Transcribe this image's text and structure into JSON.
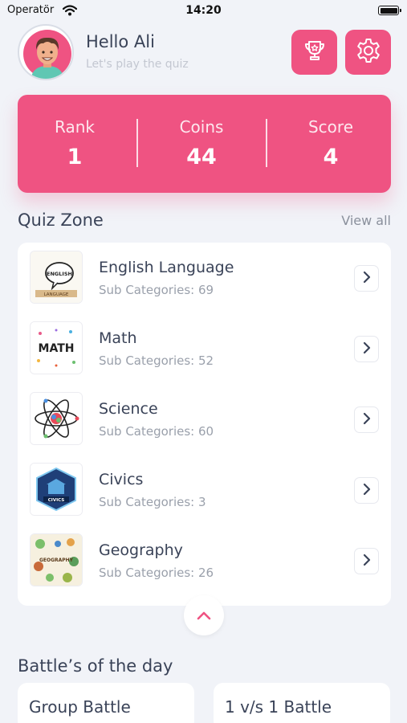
{
  "status_bar": {
    "carrier": "Operatör",
    "time": "14:20"
  },
  "header": {
    "greeting": "Hello Ali",
    "subtitle": "Let's play the quiz",
    "buttons": [
      "trophy-icon",
      "gear-icon"
    ]
  },
  "stats": {
    "rank_label": "Rank",
    "rank_value": "1",
    "coins_label": "Coins",
    "coins_value": "44",
    "score_label": "Score",
    "score_value": "4"
  },
  "quiz_zone": {
    "title": "Quiz Zone",
    "view_all": "View all",
    "items": [
      {
        "title": "English Language",
        "sub": "Sub Categories: 69",
        "thumb_text": "ENGLISH",
        "thumb_sub": "LANGUAGE"
      },
      {
        "title": "Math",
        "sub": "Sub Categories: 52",
        "thumb_text": "MATH"
      },
      {
        "title": "Science",
        "sub": "Sub Categories: 60"
      },
      {
        "title": "Civics",
        "sub": "Sub Categories: 3",
        "thumb_text": "CIVICS"
      },
      {
        "title": "Geography",
        "sub": "Sub Categories: 26",
        "thumb_text": "GEOGRAPHY"
      }
    ]
  },
  "battles": {
    "title": "Battle’s of the day",
    "group_label": "Group Battle",
    "one_v_one_label": "1 v/s 1 Battle"
  },
  "colors": {
    "accent": "#ef5382",
    "background": "#f1f3f8",
    "text_primary": "#3a4358",
    "text_secondary": "#9aa0ab"
  }
}
